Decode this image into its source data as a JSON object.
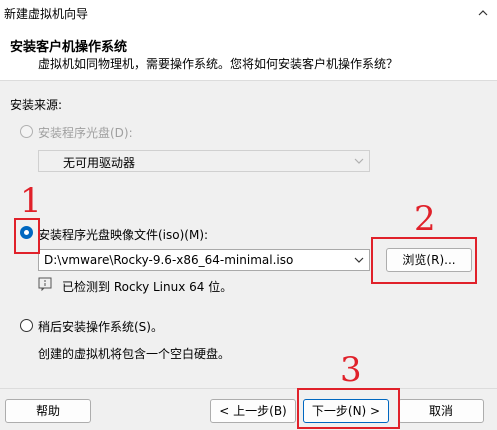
{
  "window": {
    "title": "新建虚拟机向导"
  },
  "header": {
    "title": "安装客户机操作系统",
    "subtitle": "虚拟机如同物理机，需要操作系统。您将如何安装客户机操作系统？"
  },
  "source": {
    "label": "安装来源:",
    "disc_option": "安装程序光盘(D):",
    "disc_drive": "无可用驱动器",
    "iso_option": "安装程序光盘映像文件(iso)(M):",
    "iso_path": "D:\\vmware\\Rocky-9.6-x86_64-minimal.iso",
    "browse_label": "浏览(R)...",
    "detected": "已检测到 Rocky Linux 64 位。",
    "later_option": "稍后安装操作系统(S)。",
    "later_desc": "创建的虚拟机将包含一个空白硬盘。"
  },
  "footer": {
    "help": "帮助",
    "back": "< 上一步(B)",
    "next": "下一步(N) >",
    "cancel": "取消"
  },
  "annotations": [
    "1",
    "2",
    "3"
  ],
  "colors": {
    "annotation": "#e0212a",
    "accent": "#0067c0"
  }
}
